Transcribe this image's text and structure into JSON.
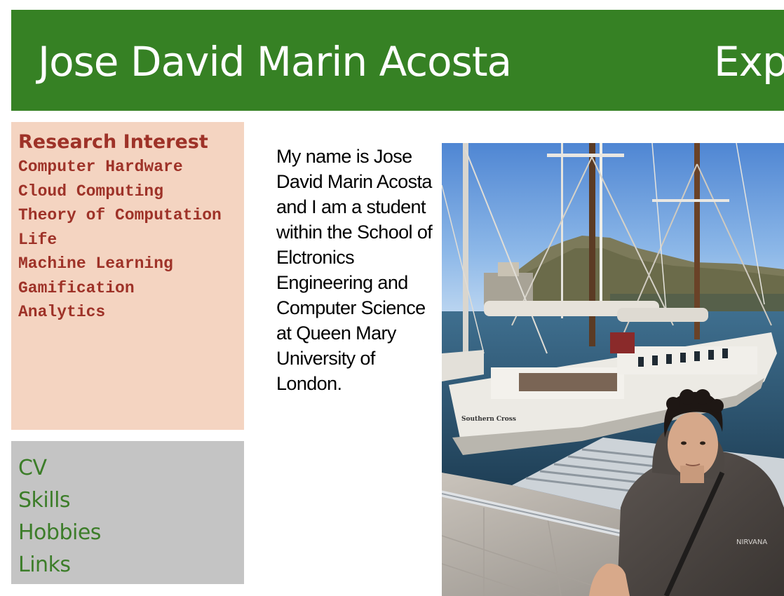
{
  "header": {
    "title": "Jose David Marin Acosta",
    "right_text": "Exp"
  },
  "research": {
    "heading": "Research Interest",
    "items": [
      "Computer Hardware",
      "Cloud Computing",
      "Theory of Computation",
      "Life",
      "Machine Learning",
      "Gamification",
      "Analytics"
    ]
  },
  "nav": {
    "links": [
      "CV",
      "Skills",
      "Hobbies",
      "Links"
    ]
  },
  "bio": {
    "text": "My name is Jose David Marin Acosta and I am a student within the School of Elctronics Engineering and Computer Science at Queen Mary University of London."
  },
  "photo": {
    "boat_name": "Southern Cross",
    "hoodie_text": "NIRVANA"
  },
  "colors": {
    "header_bg": "#368124",
    "interest_bg": "#f4d4c1",
    "interest_text": "#9e3228",
    "nav_bg": "#c4c4c4",
    "nav_link": "#3c7d29"
  }
}
